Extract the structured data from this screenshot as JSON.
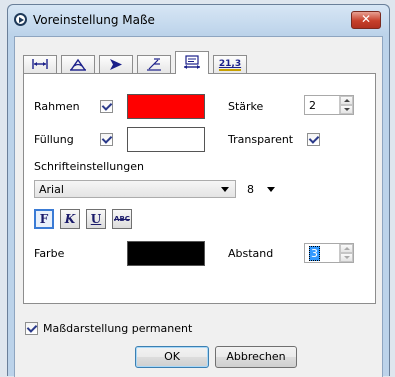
{
  "window": {
    "title": "Voreinstellung Maße",
    "close_label": "✕"
  },
  "tabs": [
    {
      "icon": "horizontal-dimension-icon",
      "active": false
    },
    {
      "icon": "angle-dimension-icon",
      "active": false
    },
    {
      "icon": "arrow-style-icon",
      "active": false
    },
    {
      "icon": "dimension-line-icon",
      "active": false
    },
    {
      "icon": "text-dimension-icon",
      "active": true
    },
    {
      "icon": "number-format-icon",
      "label": "21,3",
      "active": false
    }
  ],
  "form": {
    "rahmen_label": "Rahmen",
    "rahmen_checked": true,
    "rahmen_color": "#ff0000",
    "staerke_label": "Stärke",
    "staerke_value": "2",
    "fuellung_label": "Füllung",
    "fuellung_checked": true,
    "fuellung_color": "#ffffff",
    "transparent_label": "Transparent",
    "transparent_checked": true,
    "schrift_section_label": "Schrifteinstellungen",
    "font_value": "Arial",
    "font_size_value": "8",
    "format_buttons": [
      {
        "label": "F",
        "name": "bold-button",
        "pressed": true
      },
      {
        "label": "K",
        "name": "italic-button",
        "pressed": false
      },
      {
        "label": "U",
        "name": "underline-button",
        "pressed": false
      },
      {
        "label": "ABC",
        "name": "strikethrough-button",
        "pressed": false
      }
    ],
    "farbe_label": "Farbe",
    "farbe_color": "#000000",
    "abstand_label": "Abstand",
    "abstand_value": "3"
  },
  "footer": {
    "permanent_label": "Maßdarstellung permanent",
    "permanent_checked": true,
    "ok_label": "OK",
    "cancel_label": "Abbrechen"
  }
}
